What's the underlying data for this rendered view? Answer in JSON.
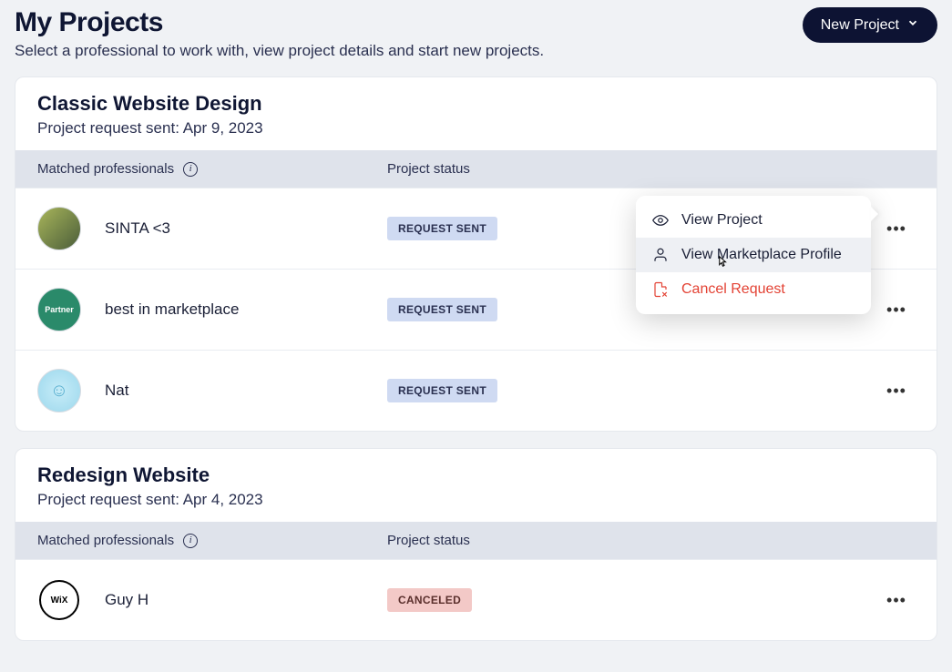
{
  "header": {
    "title": "My Projects",
    "subtitle": "Select a professional to work with, view project details and start new projects.",
    "new_project_label": "New Project"
  },
  "columns": {
    "matched": "Matched professionals",
    "status": "Project status"
  },
  "projects": [
    {
      "title": "Classic Website Design",
      "sent_label": "Project request sent: Apr 9, 2023",
      "rows": [
        {
          "name": "SINTA <3",
          "status": "REQUEST SENT",
          "status_kind": "sent",
          "avatar": "sinta"
        },
        {
          "name": "best in marketplace",
          "status": "REQUEST SENT",
          "status_kind": "sent",
          "avatar": "partner",
          "avatar_text": "Partner"
        },
        {
          "name": "Nat",
          "status": "REQUEST SENT",
          "status_kind": "sent",
          "avatar": "nat"
        }
      ]
    },
    {
      "title": "Redesign Website",
      "sent_label": "Project request sent: Apr 4, 2023",
      "rows": [
        {
          "name": "Guy H",
          "status": "CANCELED",
          "status_kind": "canceled",
          "avatar": "wix",
          "avatar_text": "WiX"
        }
      ]
    }
  ],
  "menu": {
    "view_project": "View Project",
    "view_profile": "View Marketplace Profile",
    "cancel_request": "Cancel Request"
  }
}
